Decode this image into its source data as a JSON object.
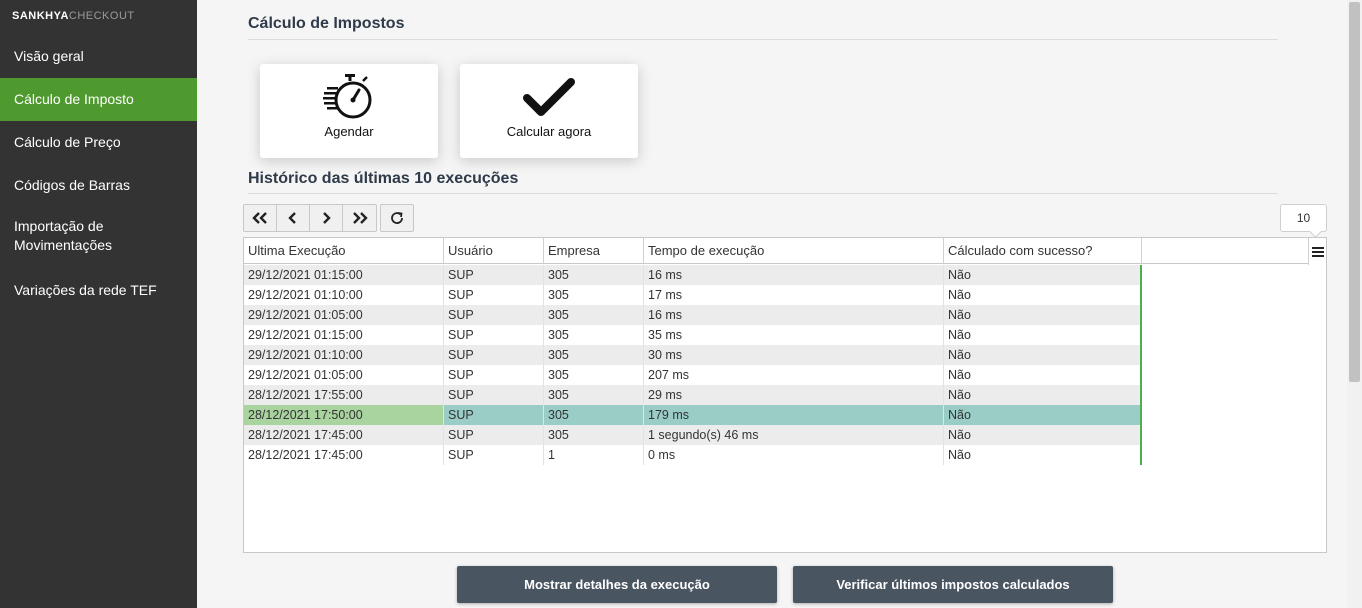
{
  "brand": {
    "part1": "SANKHYA",
    "part2": "CHECKOUT"
  },
  "sidebar": {
    "items": [
      {
        "label": "Visão geral"
      },
      {
        "label": "Cálculo de Imposto",
        "active": true
      },
      {
        "label": "Cálculo de Preço"
      },
      {
        "label": "Códigos de Barras"
      },
      {
        "label": "Importação de Movimentações"
      },
      {
        "label": "Variações da rede TEF"
      }
    ],
    "active_color": "#4e9a2e"
  },
  "page": {
    "title": "Cálculo de Impostos",
    "history_title": "Histórico das últimas 10 execuções"
  },
  "cards": {
    "schedule": {
      "label": "Agendar",
      "icon": "stopwatch-icon"
    },
    "calculate": {
      "label": "Calcular agora",
      "icon": "check-icon"
    }
  },
  "toolbar": {
    "first_icon": "double-chevron-left-icon",
    "prev_icon": "chevron-left-icon",
    "next_icon": "chevron-right-icon",
    "last_icon": "double-chevron-right-icon",
    "refresh_icon": "refresh-icon",
    "page_size": "10"
  },
  "table": {
    "headers": [
      "Ultima Execução",
      "Usuário",
      "Empresa",
      "Tempo de execução",
      "Cálculado com sucesso?"
    ],
    "rows": [
      [
        "29/12/2021 01:15:00",
        "SUP",
        "305",
        "16 ms",
        "Não"
      ],
      [
        "29/12/2021 01:10:00",
        "SUP",
        "305",
        "17 ms",
        "Não"
      ],
      [
        "29/12/2021 01:05:00",
        "SUP",
        "305",
        "16 ms",
        "Não"
      ],
      [
        "29/12/2021 01:15:00",
        "SUP",
        "305",
        "35 ms",
        "Não"
      ],
      [
        "29/12/2021 01:10:00",
        "SUP",
        "305",
        "30 ms",
        "Não"
      ],
      [
        "29/12/2021 01:05:00",
        "SUP",
        "305",
        "207 ms",
        "Não"
      ],
      [
        "28/12/2021 17:55:00",
        "SUP",
        "305",
        "29 ms",
        "Não"
      ],
      [
        "28/12/2021 17:50:00",
        "SUP",
        "305",
        "179 ms",
        "Não"
      ],
      [
        "28/12/2021 17:45:00",
        "SUP",
        "305",
        "1 segundo(s) 46 ms",
        "Não"
      ],
      [
        "28/12/2021 17:45:00",
        "SUP",
        "1",
        "0 ms",
        "Não"
      ]
    ],
    "selected_row": 7
  },
  "actions": {
    "details_label": "Mostrar detalhes da execução",
    "verify_label": "Verificar últimos impostos calculados"
  }
}
